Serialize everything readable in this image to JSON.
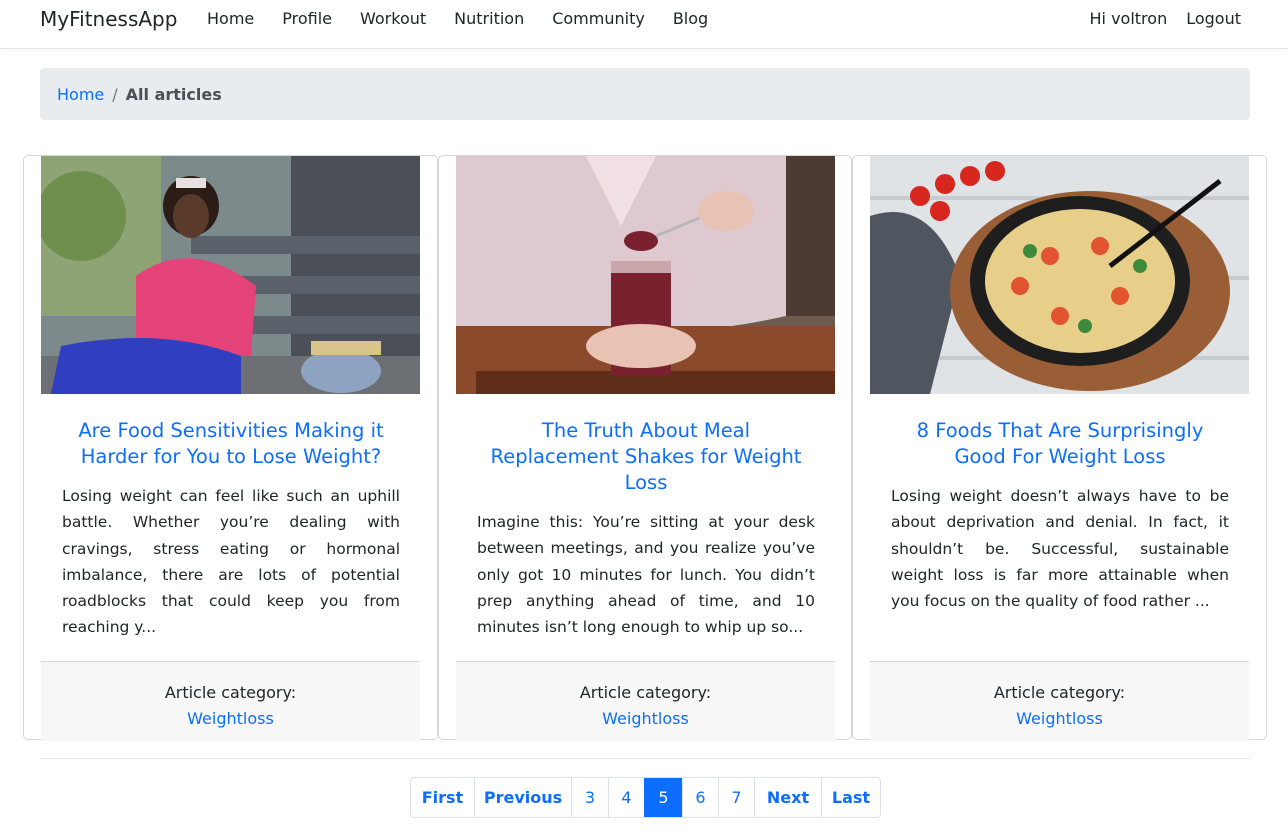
{
  "nav": {
    "brand": "MyFitnessApp",
    "links": [
      "Home",
      "Profile",
      "Workout",
      "Nutrition",
      "Community",
      "Blog"
    ],
    "greeting": "Hi voltron",
    "logout": "Logout"
  },
  "breadcrumb": {
    "home": "Home",
    "separator": "/",
    "current": "All articles"
  },
  "articles": [
    {
      "title": "Are Food Sensitivities Making it Harder for You to Lose Weight?",
      "excerpt": "Losing weight can feel like such an uphill battle. Whether you’re dealing with cravings, stress eating or hormonal imbalance, there are lots of potential roadblocks that could keep you from reaching y...",
      "category_label": "Article category:",
      "category": "Weightloss"
    },
    {
      "title": "The Truth About Meal Replacement Shakes for Weight Loss",
      "excerpt": "Imagine this: You’re sitting at your desk between meetings, and you realize you’ve only got 10 minutes for lunch. You didn’t prep anything ahead of time, and 10 minutes isn’t long enough to whip up so...",
      "category_label": "Article category:",
      "category": "Weightloss"
    },
    {
      "title": "8 Foods That Are Surprisingly Good For Weight Loss",
      "excerpt": "Losing weight doesn’t always have to be about deprivation and denial. In fact, it shouldn’t be. Successful, sustainable weight loss is far more attainable when you focus on the quality of food rather ...",
      "category_label": "Article category:",
      "category": "Weightloss"
    }
  ],
  "pagination": {
    "first": "First",
    "previous": "Previous",
    "pages": [
      "3",
      "4",
      "5",
      "6",
      "7"
    ],
    "current": "5",
    "next": "Next",
    "last": "Last"
  }
}
